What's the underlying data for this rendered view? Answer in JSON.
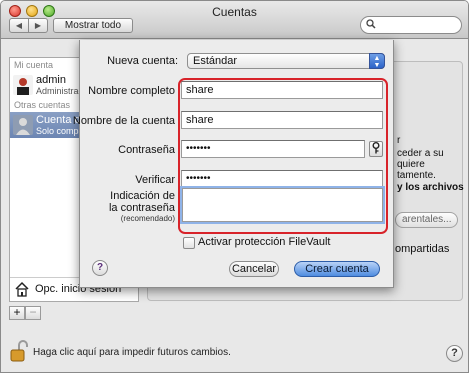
{
  "window": {
    "title": "Cuentas",
    "show_all": "Mostrar todo",
    "nav_back": "◀",
    "nav_forward": "▶"
  },
  "search": {
    "icon": "search-icon",
    "value": ""
  },
  "sidebar": {
    "section_my_account": "Mi cuenta",
    "section_other_accounts": "Otras cuentas",
    "users": [
      {
        "name": "admin",
        "role": "Administrador"
      },
      {
        "name": "Cuenta de usuario",
        "role": "Solo compartir"
      }
    ],
    "login_options": "Opc. inicio sesión",
    "add_label": "+",
    "remove_label": "−"
  },
  "background_text": {
    "line_r": "r",
    "line_acceder": "ceder a su",
    "line_quiere": "quiere",
    "line_tamente": "tamente.",
    "line_archivos": "y los archivos",
    "parental_button": "arentales...",
    "shared_folders": "ompartidas"
  },
  "footer": {
    "lock_message": "Haga clic aquí para impedir futuros cambios.",
    "help": "?"
  },
  "sheet": {
    "new_account_label": "Nueva cuenta:",
    "account_type": "Estándar",
    "full_name_label": "Nombre completo",
    "full_name_value": "share",
    "account_name_label": "Nombre de la cuenta",
    "account_name_value": "share",
    "password_label": "Contraseña",
    "password_value": "•••••••",
    "verify_label": "Verificar",
    "verify_value": "•••••••",
    "hint_label_1": "Indicación de",
    "hint_label_2": "la contraseña",
    "hint_label_3": "(recomendado)",
    "hint_value": "",
    "filevault_label": "Activar protección FileVault",
    "filevault_checked": false,
    "help": "?",
    "cancel_button": "Cancelar",
    "create_button": "Crear cuenta",
    "highlight_color": "#d8232a"
  }
}
